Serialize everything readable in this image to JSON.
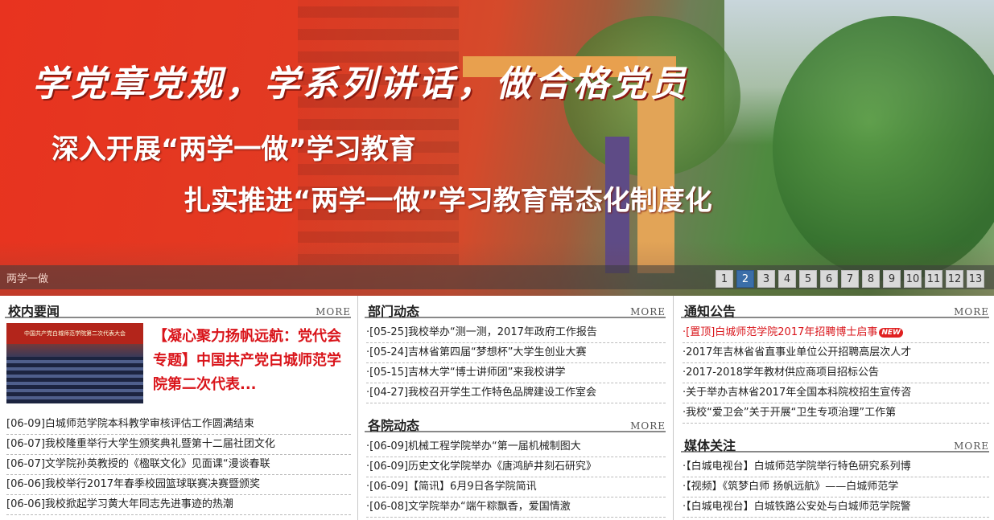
{
  "banner": {
    "slogan": "学党章党规，学系列讲话，做合格党员",
    "line2": "深入开展“两学一做”学习教育",
    "line3": "扎实推进“两学一做”学习教育常态化制度化",
    "caption": "两学一做",
    "pages": [
      "1",
      "2",
      "3",
      "4",
      "5",
      "6",
      "7",
      "8",
      "9",
      "10",
      "11",
      "12",
      "13"
    ],
    "active_page": "2"
  },
  "school_news": {
    "title": "校内要闻",
    "more": "MORE",
    "feature_text": "【凝心聚力扬帆远航：党代会专题】中国共产党白城师范学院第二次代表...",
    "feature_image_caption": "中国共产党白城师范学院第二次代表大会",
    "items": [
      "[06-09]白城师范学院本科教学审核评估工作圆满结束",
      "[06-07]我校隆重举行大学生颁奖典礼暨第十二届社团文化",
      "[06-07]文学院孙英教授的《楹联文化》见面课“漫谈春联",
      "[06-06]我校举行2017年春季校园篮球联赛决赛暨颁奖",
      "[06-06]我校掀起学习黄大年同志先进事迹的热潮"
    ]
  },
  "dept_news": {
    "title": "部门动态",
    "more": "MORE",
    "items": [
      "·[05-25]我校举办“测一测，2017年政府工作报告",
      "·[05-24]吉林省第四届“梦想杯”大学生创业大赛",
      "·[05-15]吉林大学“博士讲师团”来我校讲学",
      "·[04-27]我校召开学生工作特色品牌建设工作室会"
    ]
  },
  "college_news": {
    "title": "各院动态",
    "more": "MORE",
    "items": [
      "·[06-09]机械工程学院举办“第一届机械制图大",
      "·[06-09]历史文化学院举办《唐鸿胪井刻石研究》",
      "·[06-09]【简讯】6月9日各学院简讯",
      "·[06-08]文学院举办“端午粽飘香，爱国情激"
    ]
  },
  "notices": {
    "title": "通知公告",
    "more": "MORE",
    "items": [
      "·[置顶]白城师范学院2017年招聘博士启事",
      "·2017年吉林省省直事业单位公开招聘高层次人才",
      "·2017-2018学年教材供应商项目招标公告",
      "·关于举办吉林省2017年全国本科院校招生宣传咨",
      "·我校“爱卫会”关于开展“卫生专项治理”工作第"
    ],
    "new_badge": "NEW"
  },
  "media": {
    "title": "媒体关注",
    "more": "MORE",
    "items": [
      "·【白城电视台】白城师范学院举行特色研究系列博",
      "·【视频】《筑梦白师 扬帆远航》——白城师范学",
      "·【白城电视台】白城铁路公安处与白城师范学院警"
    ]
  }
}
